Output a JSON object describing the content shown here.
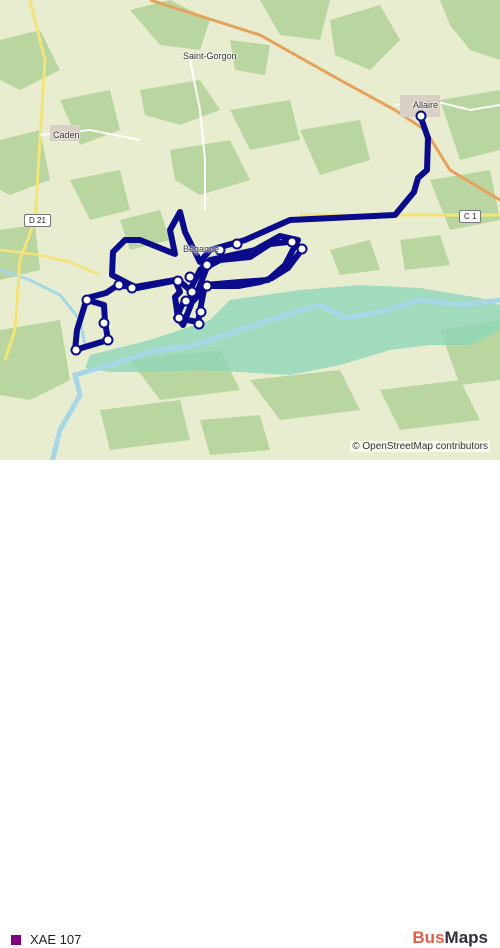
{
  "map": {
    "places": [
      {
        "name": "Saint-Gorgon"
      },
      {
        "name": "Allaire"
      },
      {
        "name": "Caden"
      },
      {
        "name": "Béganne"
      }
    ],
    "roads": [
      {
        "ref": "D 21"
      },
      {
        "ref": "C 1"
      }
    ],
    "route_color": "#0b0c8c",
    "water_color": "#a7d6e6",
    "attribution": "© OpenStreetMap contributors"
  },
  "footer": {
    "line_label": "XAE 107",
    "line_color": "#800080",
    "brand_part1": "Bus",
    "brand_part2": "Maps"
  }
}
